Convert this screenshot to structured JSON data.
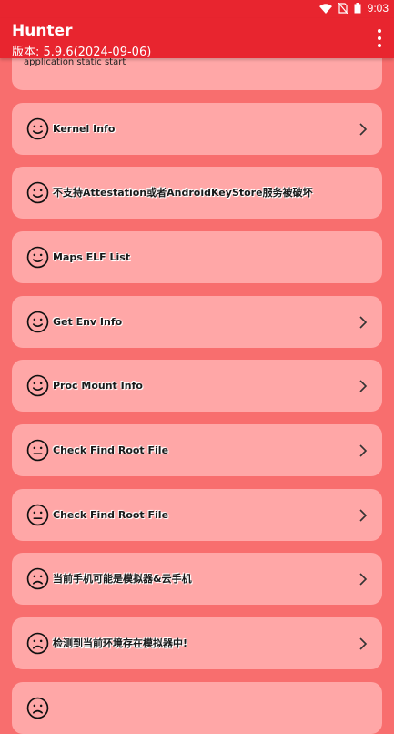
{
  "status_bar": {
    "time": "9:03",
    "icons": [
      "wifi-icon",
      "no-sim-icon",
      "battery-icon"
    ]
  },
  "app_bar": {
    "title": "Hunter",
    "version": "版本: 5.9.6(2024-09-06)",
    "menu_icon": "more-vert-icon"
  },
  "partial_item": {
    "text": "application static start"
  },
  "items": [
    {
      "label": "Kernel Info",
      "face": "smile",
      "chevron": true
    },
    {
      "label": "不支持Attestation或者AndroidKeyStore服务被破坏",
      "face": "smile",
      "chevron": false
    },
    {
      "label": "Maps ELF List",
      "face": "smile",
      "chevron": false
    },
    {
      "label": "Get Env Info",
      "face": "smile",
      "chevron": true
    },
    {
      "label": "Proc Mount Info",
      "face": "smile",
      "chevron": true
    },
    {
      "label": "Check Find Root File",
      "face": "neutral",
      "chevron": true
    },
    {
      "label": "Check Find Root File",
      "face": "neutral",
      "chevron": true
    },
    {
      "label": "当前手机可能是模拟器&云手机",
      "face": "sad",
      "chevron": true
    },
    {
      "label": "检测到当前环境存在模拟器中!",
      "face": "sad",
      "chevron": true
    },
    {
      "label": "",
      "face": "sad",
      "chevron": false
    }
  ],
  "colors": {
    "appbar": "#e8252f",
    "background": "#f86e6e",
    "card": "#ffa7a7"
  }
}
